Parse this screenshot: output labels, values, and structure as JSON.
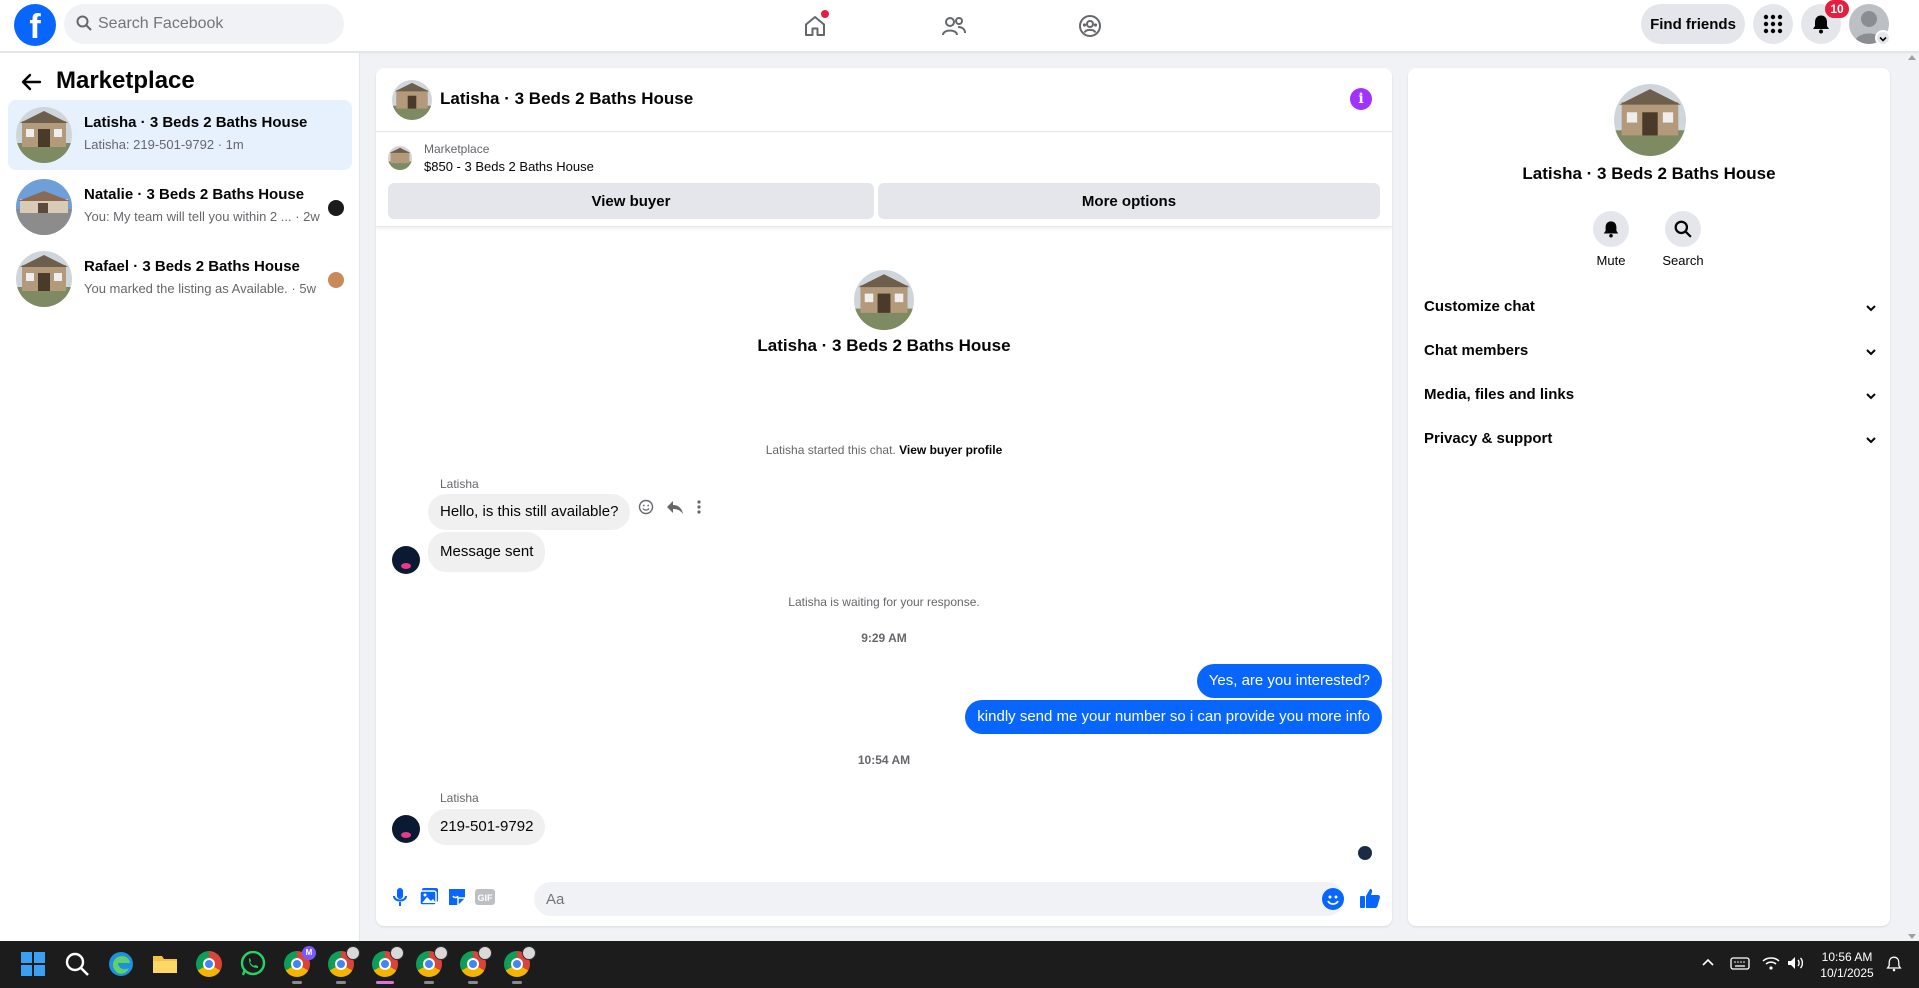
{
  "topbar": {
    "logo_letter": "f",
    "search_placeholder": "Search Facebook",
    "find_friends_label": "Find friends",
    "notification_count": "10"
  },
  "left": {
    "title": "Marketplace",
    "conversations": [
      {
        "title": "Latisha · 3 Beds 2 Baths House",
        "subtitle": "Latisha: 219-501-9792 · 1m",
        "active": true
      },
      {
        "title": "Natalie · 3 Beds 2 Baths House",
        "subtitle": "You: My team will tell you within 2 ... · 2w",
        "active": false
      },
      {
        "title": "Rafael · 3 Beds 2 Baths House",
        "subtitle": "You marked the listing as Available. · 5w",
        "active": false
      }
    ]
  },
  "chat": {
    "header_name": "Latisha · 3 Beds 2 Baths House",
    "info_icon": "i",
    "listing_source": "Marketplace",
    "listing_price_title": "$850 - 3 Beds 2 Baths House",
    "view_buyer_label": "View buyer",
    "more_options_label": "More options",
    "intro_name": "Latisha · 3 Beds 2 Baths House",
    "started_text": "Latisha started this chat.",
    "view_buyer_profile": "View buyer profile",
    "sender_1": "Latisha",
    "msg_1": "Hello, is this still available?",
    "msg_2": "Message sent",
    "waiting_text": "Latisha is waiting for your response.",
    "time_1": "9:29 AM",
    "out_1": "Yes, are you interested?",
    "out_2": "kindly send me your number so i can provide you more info",
    "time_2": "10:54 AM",
    "sender_2": "Latisha",
    "msg_3": "219-501-9792",
    "composer_placeholder": "Aa",
    "gif_label": "GIF"
  },
  "right": {
    "name": "Latisha · 3 Beds 2 Baths House",
    "mute_label": "Mute",
    "search_label": "Search",
    "sections": [
      "Customize chat",
      "Chat members",
      "Media, files and links",
      "Privacy & support"
    ]
  },
  "taskbar": {
    "time": "10:56 AM",
    "date": "10/1/2025",
    "profile_badge": "M"
  },
  "colors": {
    "brand_blue": "#0866ff",
    "active_row": "#e7f0fd",
    "info_purple": "#a033ff",
    "badge_red": "#e41e3f"
  }
}
